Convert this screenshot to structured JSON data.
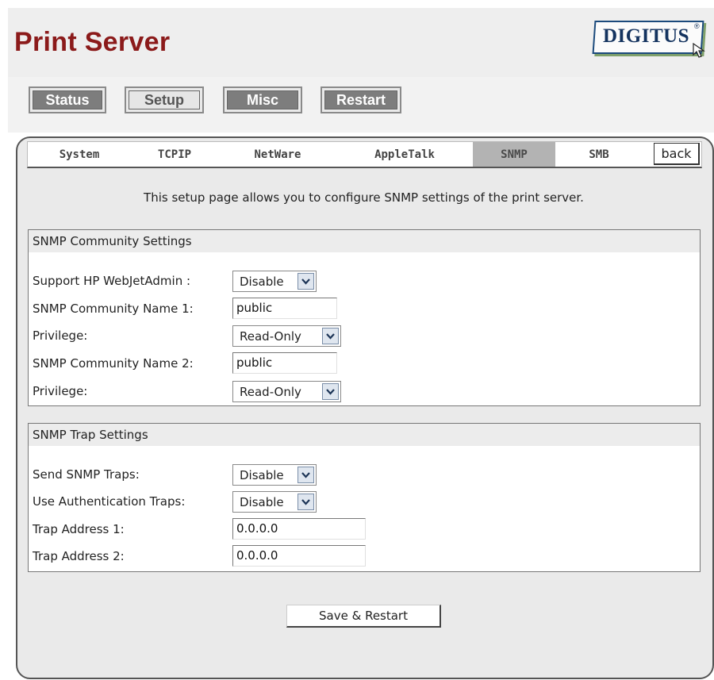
{
  "header": {
    "title": "Print Server",
    "logo": {
      "text": "DIGITUS",
      "reg_mark": "®",
      "cursor_icon": "cursor-arrow-icon"
    }
  },
  "nav": {
    "buttons": [
      {
        "label": "Status",
        "style": "dark"
      },
      {
        "label": "Setup",
        "style": "light"
      },
      {
        "label": "Misc",
        "style": "dark"
      },
      {
        "label": "Restart",
        "style": "dark"
      }
    ]
  },
  "tabs": {
    "items": [
      {
        "label": "System",
        "active": false
      },
      {
        "label": "TCPIP",
        "active": false
      },
      {
        "label": "NetWare",
        "active": false
      },
      {
        "label": "AppleTalk",
        "active": false
      },
      {
        "label": "SNMP",
        "active": true
      },
      {
        "label": "SMB",
        "active": false
      }
    ],
    "back_label": "back"
  },
  "intro": "This setup page allows you to configure SNMP settings of the print server.",
  "community": {
    "heading": "SNMP Community Settings",
    "webjetadmin": {
      "label": "Support HP WebJetAdmin :",
      "value": "Disable"
    },
    "name1": {
      "label": "SNMP Community Name 1:",
      "value": "public"
    },
    "privilege1": {
      "label": "Privilege:",
      "value": "Read-Only"
    },
    "name2": {
      "label": "SNMP Community Name 2:",
      "value": "public"
    },
    "privilege2": {
      "label": "Privilege:",
      "value": "Read-Only"
    }
  },
  "trap": {
    "heading": "SNMP Trap Settings",
    "send": {
      "label": "Send SNMP Traps:",
      "value": "Disable"
    },
    "auth": {
      "label": "Use Authentication Traps:",
      "value": "Disable"
    },
    "addr1": {
      "label": "Trap Address 1:",
      "value": "0.0.0.0"
    },
    "addr2": {
      "label": "Trap Address 2:",
      "value": "0.0.0.0"
    }
  },
  "actions": {
    "save_label": "Save & Restart"
  },
  "colors": {
    "title": "#8b1a1a",
    "logo": "#14335f",
    "active_tab": "#b3b3b3",
    "panel_bg": "#eaeaea"
  }
}
